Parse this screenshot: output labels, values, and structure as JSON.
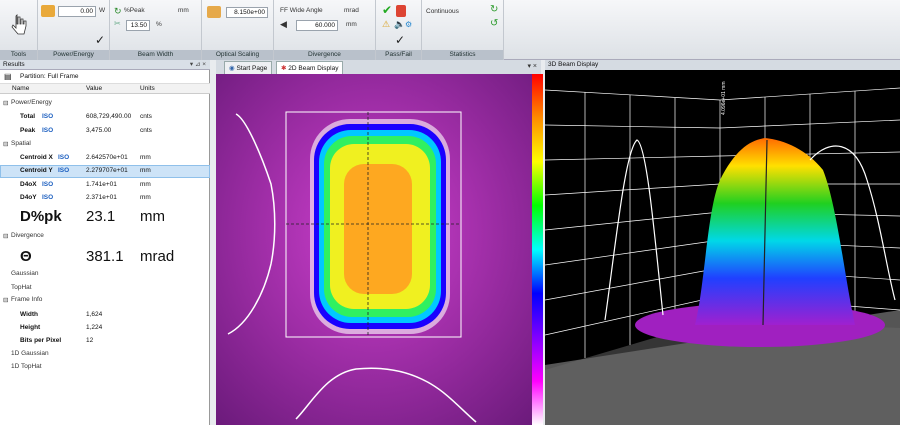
{
  "ribbon": {
    "tools_label": "Tools",
    "power": {
      "value": "0.00",
      "unit": "W",
      "label": "Power/Energy"
    },
    "beam_width": {
      "method": "%Peak",
      "unit": "mm",
      "value": "13.50",
      "value_unit": "%",
      "label": "Beam Width"
    },
    "optical_scaling": {
      "value": "8.150e+00",
      "label": "Optical Scaling"
    },
    "divergence": {
      "method": "FF Wide Angle",
      "unit": "mrad",
      "value": "60.000",
      "value_unit": "mm",
      "label": "Divergence"
    },
    "pass_fail": {
      "label": "Pass/Fail"
    },
    "statistics": {
      "mode": "Continuous",
      "label": "Statistics"
    }
  },
  "results": {
    "title": "Results",
    "partition": "Partition:  Full Frame",
    "columns": {
      "name": "Name",
      "value": "Value",
      "units": "Units"
    },
    "power_section": "Power/Energy",
    "total": {
      "name": "Total",
      "iso": "ISO",
      "value": "608,729,490.00",
      "unit": "cnts"
    },
    "peak": {
      "name": "Peak",
      "iso": "ISO",
      "value": "3,475.00",
      "unit": "cnts"
    },
    "spatial_section": "Spatial",
    "centroid_x": {
      "name": "Centroid X",
      "iso": "ISO",
      "value": "2.642570e+01",
      "unit": "mm"
    },
    "centroid_y": {
      "name": "Centroid Y",
      "iso": "ISO",
      "value": "2.279707e+01",
      "unit": "mm"
    },
    "d4ox": {
      "name": "D4oX",
      "iso": "ISO",
      "value": "1.741e+01",
      "unit": "mm"
    },
    "d4oy": {
      "name": "D4oY",
      "iso": "ISO",
      "value": "2.371e+01",
      "unit": "mm"
    },
    "dpk": {
      "name": "D%pk",
      "value": "23.1",
      "unit": "mm"
    },
    "divergence_section": "Divergence",
    "theta": {
      "name": "Θ",
      "value": "381.1",
      "unit": "mrad"
    },
    "gaussian": "Gaussian",
    "tophat": "TopHat",
    "frame_section": "Frame Info",
    "width": {
      "name": "Width",
      "value": "1,624"
    },
    "height": {
      "name": "Height",
      "value": "1,224"
    },
    "bpp": {
      "name": "Bits per Pixel",
      "value": "12"
    },
    "gauss1d": "1D Gaussian",
    "tophat1d": "1D TopHat"
  },
  "tabs": {
    "start": "Start Page",
    "beam2d": "2D Beam Display"
  },
  "display3d": {
    "title": "3D Beam Display",
    "axis_value": "4.096e+01 mm"
  },
  "colors": {
    "accent": "#1c5fc0",
    "selected_row": "#cde3f7",
    "beam_bg": "#c33bc8"
  }
}
